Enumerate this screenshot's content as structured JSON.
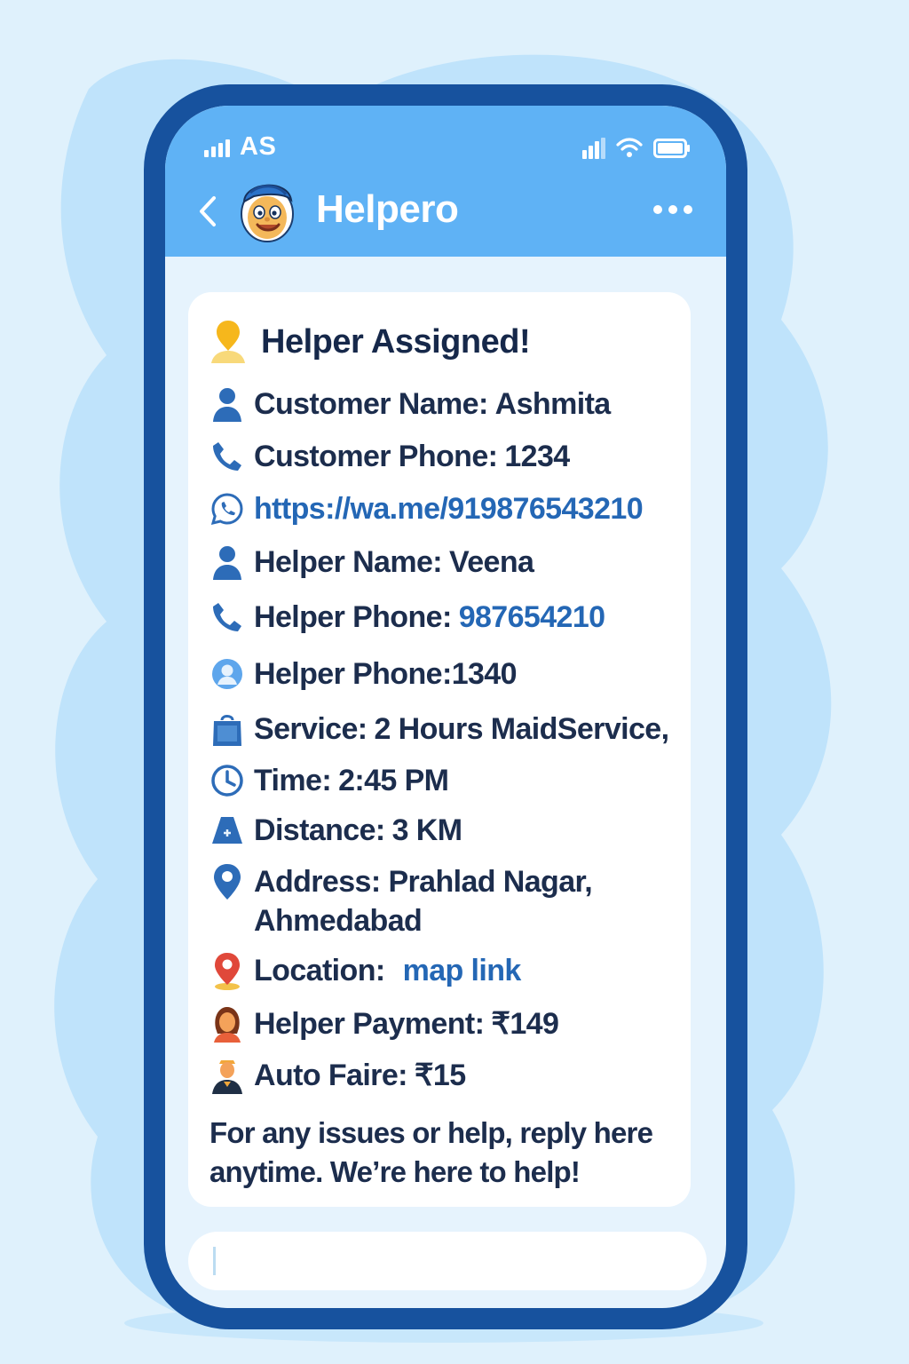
{
  "status_bar": {
    "carrier": "AS"
  },
  "header": {
    "app_title": "Helpero"
  },
  "message": {
    "title": "Helper Assigned!",
    "customer_name": {
      "label": "Customer Name:",
      "value": "Ashmita"
    },
    "customer_phone": {
      "label": "Customer Phone:",
      "value": "1234"
    },
    "whatsapp_link": "https://wa.me/919876543210",
    "helper_name": {
      "label": "Helper Name:",
      "value": "Veena"
    },
    "helper_phone": {
      "label": "Helper Phone:",
      "value": "987654210"
    },
    "helper_phone_2": {
      "label": "Helper Phone:",
      "value": "1340"
    },
    "service": {
      "label": "Service:",
      "value": "2 Hours MaidService,"
    },
    "time": {
      "label": "Time:",
      "value": "2:45 PM"
    },
    "distance": {
      "label": "Distance:",
      "value": "3 KM"
    },
    "address": {
      "label": "Address:",
      "value_line1": "Prahlad Nagar,",
      "value_line2": "Ahmedabad"
    },
    "location": {
      "label": "Location:",
      "value": "map link"
    },
    "helper_payment": {
      "label": "Helper Payment:",
      "value": "₹149"
    },
    "auto_fare": {
      "label": "Auto Faire:",
      "value": "₹15"
    },
    "footer_line1": "For any issues or help, reply here",
    "footer_line2": "anytime. We’re here to help!"
  },
  "icons": {
    "title": "person-pin-icon",
    "customer_name": "person-icon",
    "customer_phone": "phone-icon",
    "whatsapp": "whatsapp-icon",
    "helper_name": "person-icon",
    "helper_phone": "phone-icon",
    "helper_phone_2": "user-circle-icon",
    "service": "bag-icon",
    "time": "clock-icon",
    "distance": "distance-icon",
    "address": "map-pin-icon",
    "location": "location-pin-icon",
    "helper_payment": "woman-icon",
    "auto_fare": "driver-icon"
  },
  "colors": {
    "background": "#dff1fc",
    "phone_frame": "#17529e",
    "header": "#5fb2f5",
    "link": "#2467b5",
    "text": "#1c2d4d",
    "icon_blue": "#2d6cb8"
  }
}
